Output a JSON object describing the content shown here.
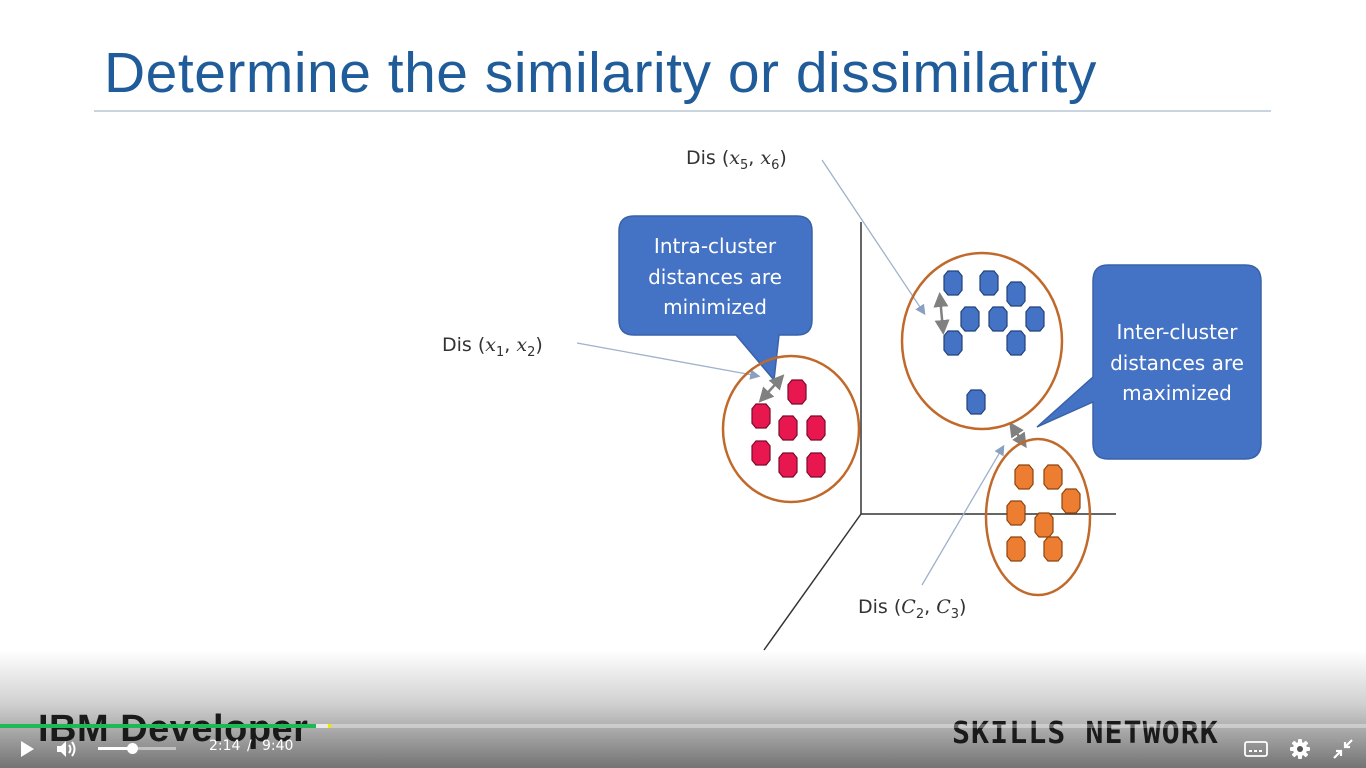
{
  "slide": {
    "title": "Determine the similarity or dissimilarity",
    "labels": {
      "dis_x5_x6": {
        "prefix": "Dis",
        "a": "x",
        "a_sub": "5",
        "b": "x",
        "b_sub": "6"
      },
      "dis_x1_x2": {
        "prefix": "Dis",
        "a": "x",
        "a_sub": "1",
        "b": "x",
        "b_sub": "2"
      },
      "dis_c2_c3": {
        "prefix": "Dis",
        "a": "C",
        "a_sub": "2",
        "b": "C",
        "b_sub": "3"
      }
    },
    "callouts": {
      "intra": [
        "Intra-cluster",
        "distances are",
        "minimized"
      ],
      "inter": [
        "Inter-cluster",
        "distances are",
        "maximized"
      ]
    },
    "colors": {
      "callout_fill": "#4472c4",
      "cluster_ring": "#c0692a",
      "red_points": "#e8174f",
      "blue_points": "#4472c4",
      "orange_points": "#ed7d31",
      "title": "#1f5c99"
    },
    "clusters": [
      {
        "name": "red",
        "point_count": 7
      },
      {
        "name": "blue",
        "point_count": 10
      },
      {
        "name": "orange",
        "point_count": 7
      }
    ]
  },
  "video": {
    "brand_left": "IBM Developer",
    "brand_right": "SKILLS NETWORK",
    "current_time": "2:14",
    "time_separator": "/",
    "duration": "9:40",
    "progress_fraction": 0.231,
    "buffered_fraction": 0.24,
    "volume_fraction": 0.43,
    "progress_color": "#1db954",
    "buffer_marker_color": "#f2e600",
    "icons": {
      "play": "play-icon",
      "volume": "volume-icon",
      "captions": "captions-icon",
      "settings": "gear-icon",
      "exit_fullscreen": "exit-fullscreen-icon"
    }
  }
}
